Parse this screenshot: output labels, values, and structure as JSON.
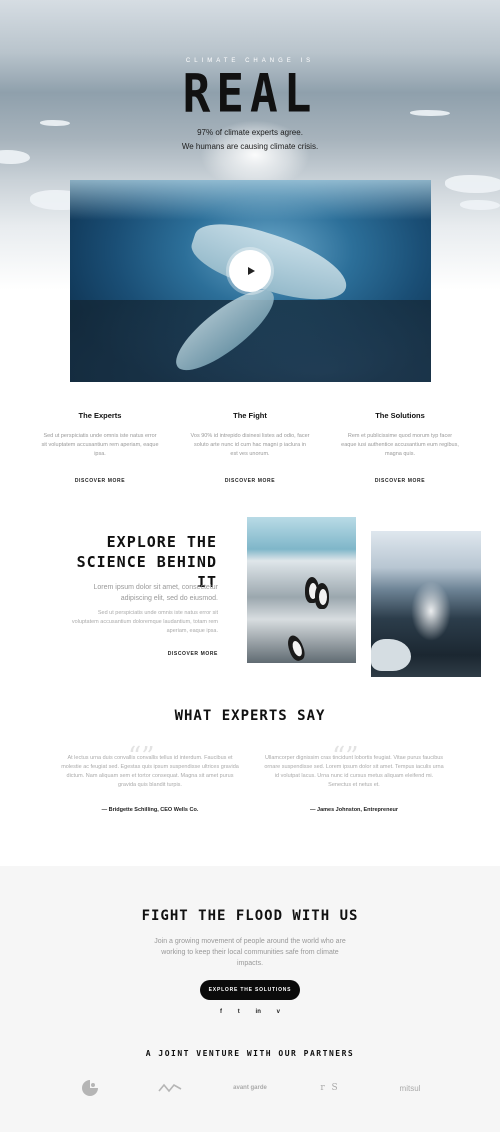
{
  "hero": {
    "eyebrow": "CLIMATE CHANGE IS",
    "title": "REAL",
    "line1": "97% of climate experts agree.",
    "line2": "We humans are causing climate crisis."
  },
  "video": {
    "play_icon": "play-icon"
  },
  "columns": [
    {
      "title": "The Experts",
      "text": "Sed ut perspiciatis unde omnis iste natus error sit voluptatem accusantium rem aperiam, eaque ipsa.",
      "link": "DISCOVER MORE"
    },
    {
      "title": "The Fight",
      "text": "Vos 90% id intrepido disinesi listes ad odio, facer soluto arte nunc id cum hac magni p iaclura in est ves unorum.",
      "link": "DISCOVER MORE"
    },
    {
      "title": "The Solutions",
      "text": "Rem et publicissime quod morum typ facer eaque iusi authentice accusantium eum regibus, magna quis.",
      "link": "DISCOVER MORE"
    }
  ],
  "explore": {
    "title_line1": "EXPLORE THE",
    "title_line2": "SCIENCE BEHIND IT",
    "lead": "Lorem ipsum dolor sit amet, consectetur adipiscing elit, sed do eiusmod.",
    "body": "Sed ut perspiciatis unde omnis iste natus error sit voluptatem accusantium doloremque laudantium, totam rem aperiam, eaque ipsa.",
    "link": "DISCOVER MORE"
  },
  "experts": {
    "title": "WHAT EXPERTS SAY",
    "quotes": [
      {
        "text": "At lectus urna duis convallis convallis tellus id interdum. Faucibus et molestie ac feugiat sed. Egestas quis ipsum suspendisse ultrices gravida dictum. Nam aliquam sem et tortor consequat. Magna sit amet purus gravida quis blandit turpis.",
        "author": "— Bridgette Schilling, CEO Wells Co."
      },
      {
        "text": "Ullamcorper dignissim cras tincidunt lobortis feugiat. Vitae purus faucibus ornare suspendisse sed. Lorem ipsum dolor sit amet. Tempus iaculis urna id volutpat lacus. Urna nunc id cursus metus aliquam eleifend mi. Senectus et netus et.",
        "author": "— James Johnston, Entrepreneur"
      }
    ]
  },
  "cta": {
    "title": "FIGHT THE FLOOD WITH US",
    "text": "Join a growing movement of people around the world who are working to keep their local communities safe from climate impacts.",
    "button": "EXPLORE THE SOLUTIONS",
    "socials": [
      "f",
      "t",
      "in",
      "v"
    ]
  },
  "partners": {
    "title": "A JOINT VENTURE WITH OUR PARTNERS",
    "logos": [
      "",
      "",
      "avant garde",
      "r S",
      "mitsul"
    ]
  }
}
